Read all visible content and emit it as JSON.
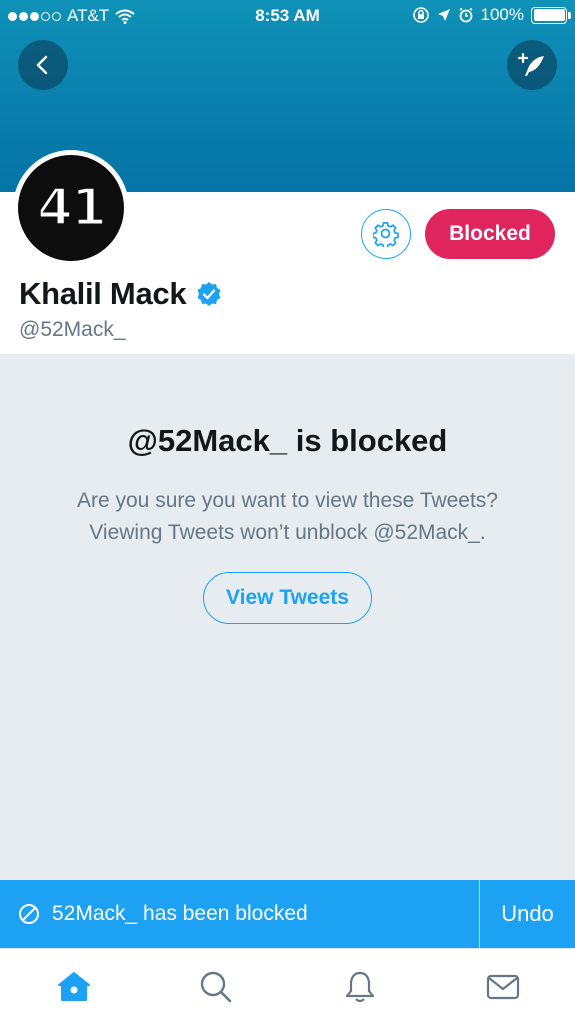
{
  "status_bar": {
    "carrier": "AT&T",
    "time": "8:53 AM",
    "battery": "100%"
  },
  "profile": {
    "avatar_text": "41",
    "name": "Khalil Mack",
    "handle": "@52Mack_",
    "verified": true,
    "blocked_label": "Blocked"
  },
  "blocked_notice": {
    "title": "@52Mack_ is blocked",
    "line1": "Are you sure you want to view these Tweets?",
    "line2": "Viewing Tweets won’t unblock @52Mack_.",
    "view_button": "View Tweets"
  },
  "toast": {
    "message": "52Mack_ has been blocked",
    "undo_label": "Undo"
  },
  "tab_bar": {
    "items": [
      "home-icon",
      "search-icon",
      "notifications-icon",
      "messages-icon"
    ],
    "active": "home-icon"
  },
  "colors": {
    "accent": "#1da1f2",
    "blocked": "#e0245e",
    "banner": "#0a7fad",
    "background_gray": "#e6ecf0"
  }
}
